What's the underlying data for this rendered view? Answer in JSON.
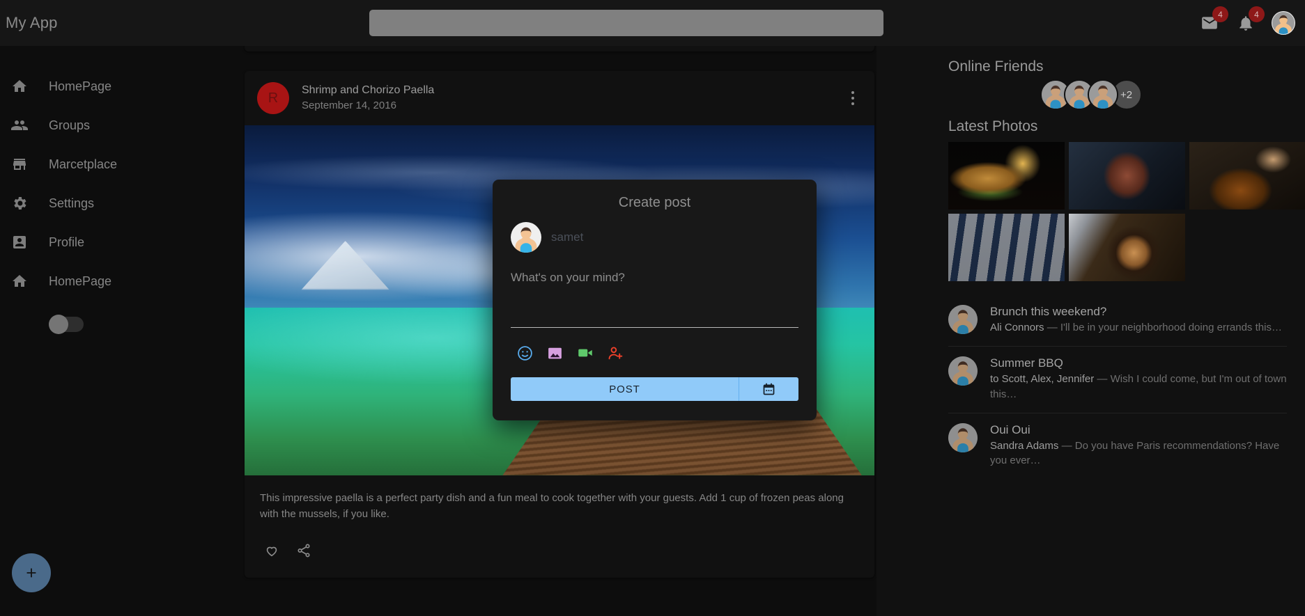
{
  "header": {
    "app_title": "My App",
    "search": {
      "value": "",
      "placeholder": ""
    },
    "mail_badge": "4",
    "bell_badge": "4"
  },
  "sidebar": {
    "items": [
      {
        "label": "HomePage",
        "icon": "home-icon"
      },
      {
        "label": "Groups",
        "icon": "people-icon"
      },
      {
        "label": "Marcetplace",
        "icon": "store-icon"
      },
      {
        "label": "Settings",
        "icon": "gear-icon"
      },
      {
        "label": "Profile",
        "icon": "account-box-icon"
      },
      {
        "label": "HomePage",
        "icon": "home-icon"
      }
    ],
    "theme_toggle": {
      "icon": "moon-icon",
      "state": "off"
    },
    "fab": {
      "icon": "plus-icon",
      "label": "+"
    }
  },
  "feed": {
    "post": {
      "avatar_letter": "R",
      "title": "Shrimp and Chorizo Paella",
      "date": "September 14, 2016",
      "menu_icon": "more-vert-icon",
      "image_alt": "wooden pier over turquoise sea under blue sky",
      "description": "This impressive paella is a perfect party dish and a fun meal to cook together with your guests. Add 1 cup of frozen peas along with the mussels, if you like.",
      "actions": [
        {
          "name": "like",
          "icon": "heart-icon"
        },
        {
          "name": "share",
          "icon": "share-icon"
        }
      ]
    }
  },
  "right_panel": {
    "online_friends_title": "Online Friends",
    "friends_avatars": 3,
    "friends_overflow": "+2",
    "latest_photos_title": "Latest Photos",
    "photos": [
      {
        "name": "burger-and-fries",
        "class": "ph-burger"
      },
      {
        "name": "vintage-camera",
        "class": "ph-camera"
      },
      {
        "name": "honey-jar",
        "class": "ph-honey"
      },
      {
        "name": "straw-hats",
        "class": "ph-hats"
      },
      {
        "name": "latte-and-laptop",
        "class": "ph-coffee"
      }
    ],
    "conversations": [
      {
        "title": "Brunch this weekend?",
        "sender": "Ali Connors",
        "preview": " — I'll be in your neighborhood doing errands this…"
      },
      {
        "title": "Summer BBQ",
        "sender": "to Scott, Alex, Jennifer",
        "preview": " — Wish I could come, but I'm out of town this…"
      },
      {
        "title": "Oui Oui",
        "sender": "Sandra Adams",
        "preview": " — Do you have Paris recommendations? Have you ever…"
      }
    ]
  },
  "modal": {
    "title": "Create post",
    "user_name": "samet",
    "field_value": "",
    "field_placeholder": "What's on your mind?",
    "icons": [
      {
        "name": "emoji-icon",
        "color": "#5aaef0"
      },
      {
        "name": "photo-icon",
        "color": "#d7a0e0"
      },
      {
        "name": "video-icon",
        "color": "#5fc96b"
      },
      {
        "name": "person-add-icon",
        "color": "#f0412a"
      }
    ],
    "post_label": "POST",
    "calendar_icon": "calendar-icon",
    "accent": "#90caf9"
  }
}
